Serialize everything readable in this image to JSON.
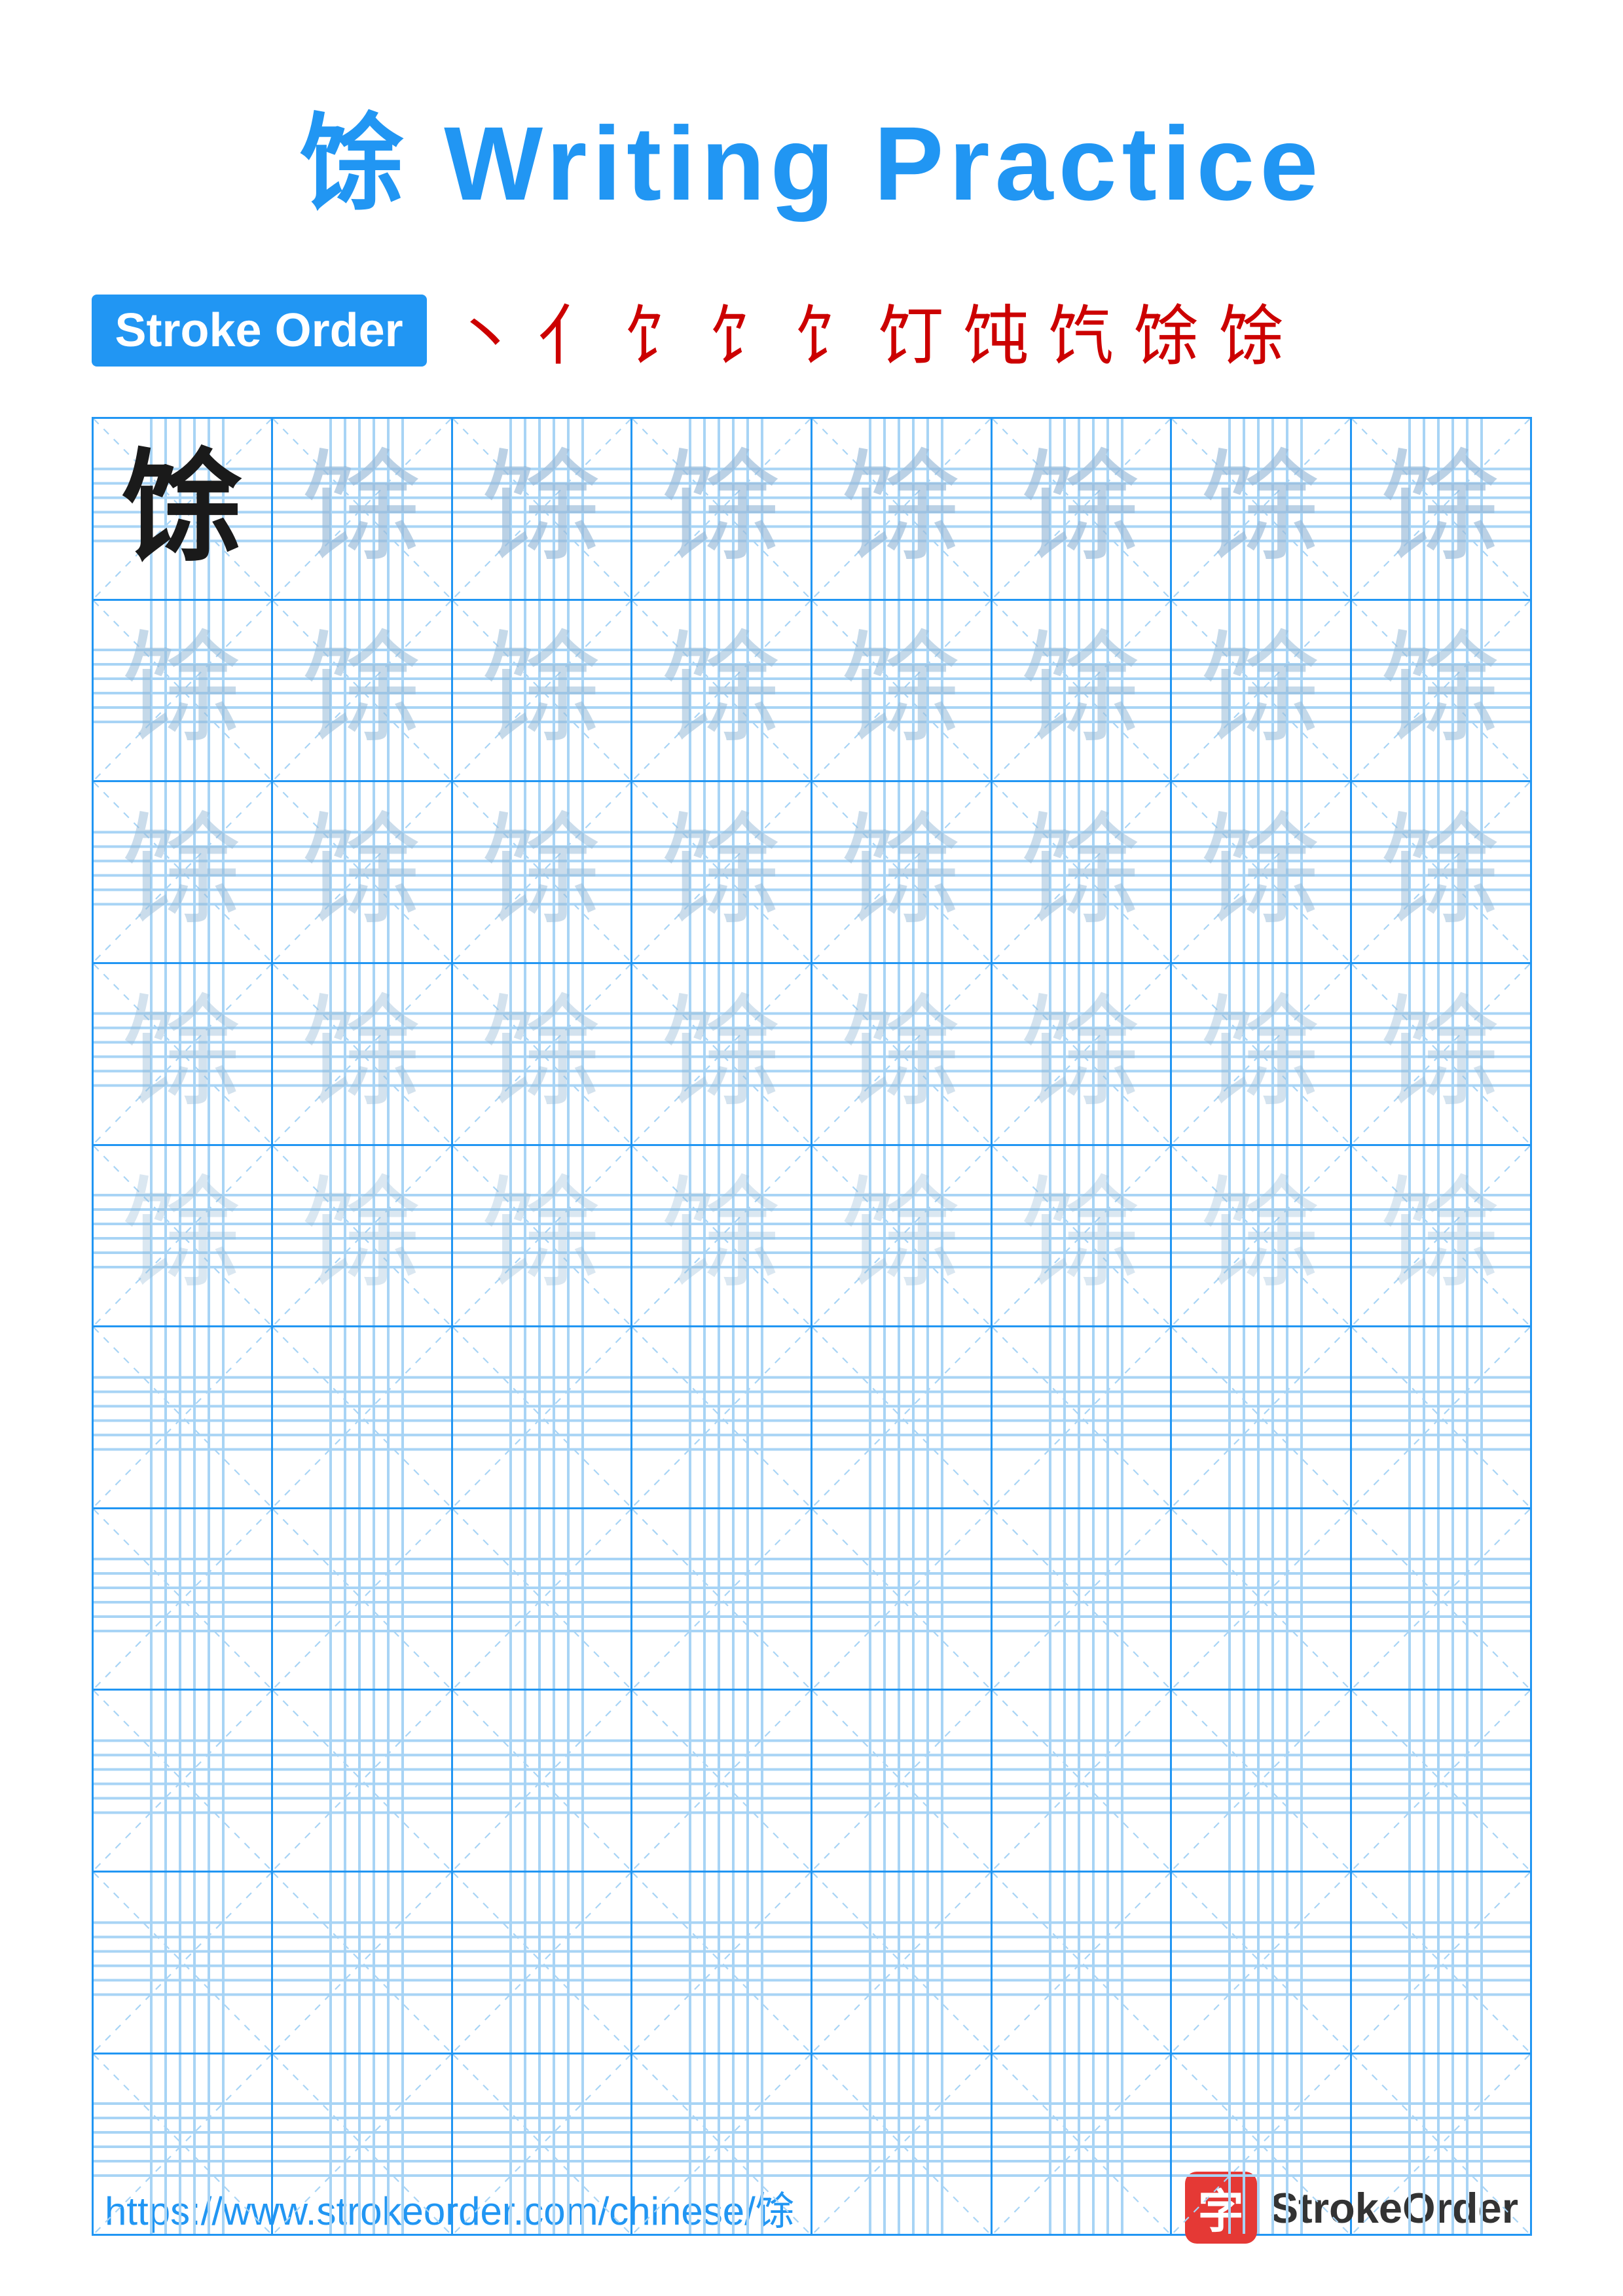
{
  "title": {
    "char": "馀",
    "rest": " Writing Practice",
    "full": "馀 Writing Practice"
  },
  "stroke_order": {
    "badge_label": "Stroke Order",
    "strokes": [
      "丶",
      "亻",
      "⺁",
      "饣",
      "饣",
      "饣",
      "饣",
      "饣",
      "馀",
      "馀"
    ]
  },
  "grid": {
    "rows": 10,
    "cols": 8,
    "char": "馀",
    "guide_rows": 5,
    "empty_rows": 5
  },
  "footer": {
    "url": "https://www.strokeorder.com/chinese/馀",
    "logo_char": "字",
    "logo_text": "StrokeOrder"
  }
}
